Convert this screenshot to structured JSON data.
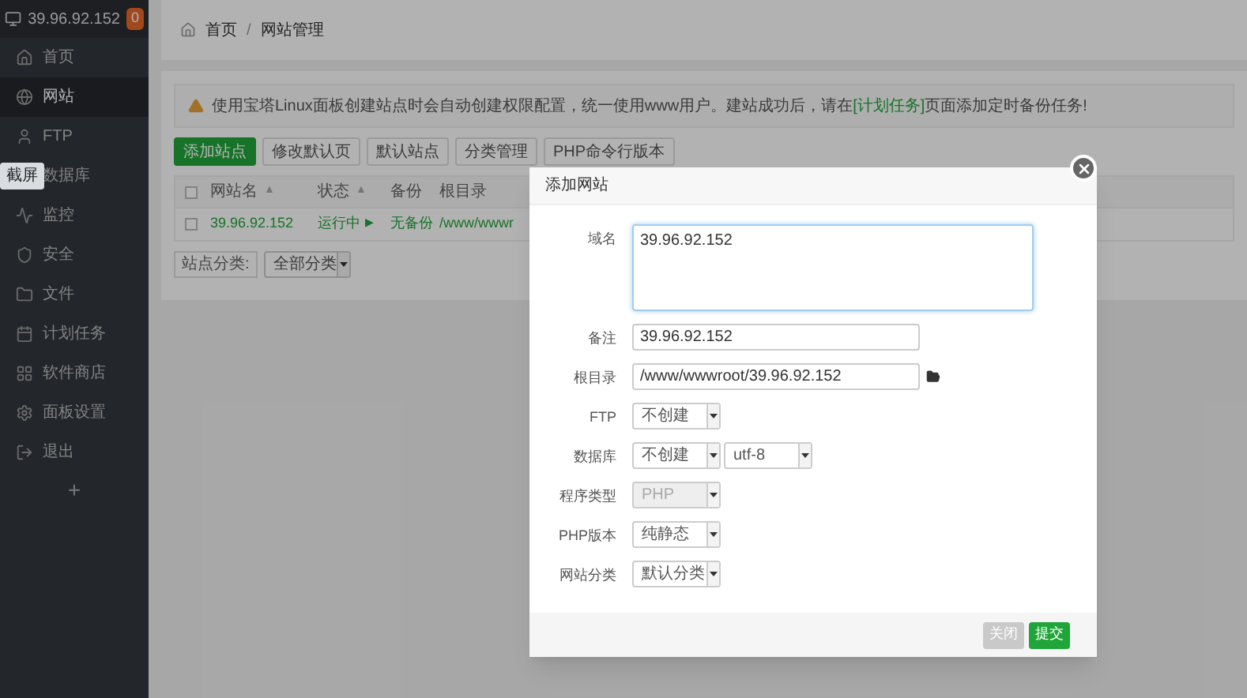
{
  "sidebar": {
    "host": "39.96.92.152",
    "badge": "0",
    "add": "+",
    "items": [
      {
        "label": "首页",
        "selected": false
      },
      {
        "label": "网站",
        "selected": true
      },
      {
        "label": "FTP",
        "selected": false
      },
      {
        "label": "数据库",
        "selected": false
      },
      {
        "label": "监控",
        "selected": false
      },
      {
        "label": "安全",
        "selected": false
      },
      {
        "label": "文件",
        "selected": false
      },
      {
        "label": "计划任务",
        "selected": false
      },
      {
        "label": "软件商店",
        "selected": false
      },
      {
        "label": "面板设置",
        "selected": false
      },
      {
        "label": "退出",
        "selected": false
      }
    ]
  },
  "tooltip": "截屏",
  "breadcrumb": {
    "home": "首页",
    "separator": "/",
    "current": "网站管理"
  },
  "alert": {
    "before": "使用宝塔Linux面板创建站点时会自动创建权限配置，统一使用www用户。建站成功后，请在",
    "link": "[计划任务]",
    "after": "页面添加定时备份任务!"
  },
  "toolbar": [
    {
      "label": "添加站点",
      "kind": "primary"
    },
    {
      "label": "修改默认页",
      "kind": "default"
    },
    {
      "label": "默认站点",
      "kind": "default"
    },
    {
      "label": "分类管理",
      "kind": "default"
    },
    {
      "label": "PHP命令行版本",
      "kind": "default"
    }
  ],
  "table": {
    "all_checked": false,
    "columns": [
      {
        "label": "网站名",
        "sort": "▲"
      },
      {
        "label": "状态",
        "sort": "▲"
      },
      {
        "label": "备份"
      },
      {
        "label": "根目录"
      }
    ],
    "rows": [
      {
        "checked": false,
        "name": "39.96.92.152",
        "status": "运行中",
        "status_icon": "▶",
        "backup": "无备份",
        "path": "/www/wwwr"
      }
    ]
  },
  "filter": {
    "label": "站点分类:",
    "value": "全部分类"
  },
  "dialog": {
    "title": "添加网站",
    "fields": [
      {
        "kind": "textarea",
        "label": "域名",
        "value": "39.96.92.152"
      },
      {
        "kind": "text",
        "label": "备注",
        "value": "39.96.92.152"
      },
      {
        "kind": "path",
        "label": "根目录",
        "value": "/www/wwwroot/39.96.92.152"
      },
      {
        "kind": "select",
        "label": "FTP",
        "values": [
          "不创建"
        ],
        "disabled": false
      },
      {
        "kind": "select",
        "label": "数据库",
        "values": [
          "不创建",
          "utf-8"
        ],
        "disabled": false
      },
      {
        "kind": "select",
        "label": "程序类型",
        "values": [
          "PHP"
        ],
        "disabled": true
      },
      {
        "kind": "select",
        "label": "PHP版本",
        "values": [
          "纯静态"
        ],
        "disabled": false
      },
      {
        "kind": "select",
        "label": "网站分类",
        "values": [
          "默认分类"
        ],
        "disabled": false
      }
    ],
    "buttons": [
      {
        "label": "关闭",
        "kind": "cancel"
      },
      {
        "label": "提交",
        "kind": "primary"
      }
    ]
  }
}
